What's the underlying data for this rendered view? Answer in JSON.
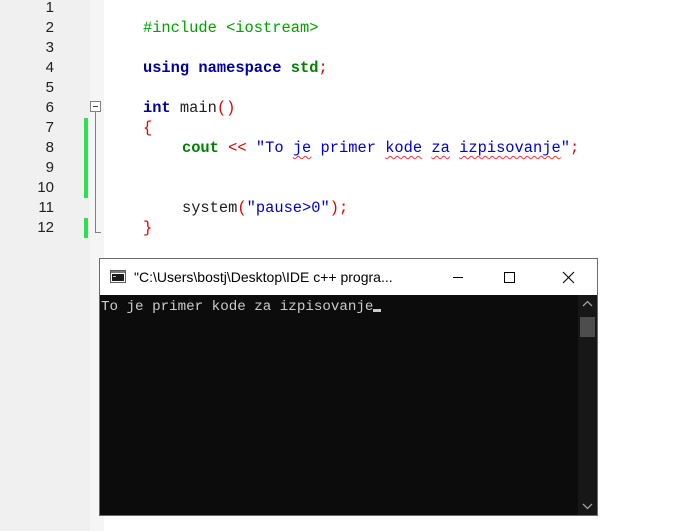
{
  "editor": {
    "line_numbers": [
      "1",
      "2",
      "3",
      "4",
      "5",
      "6",
      "7",
      "8",
      "9",
      "10",
      "11",
      "12"
    ],
    "lines": {
      "l1_include": "#include <iostream>",
      "l3_using": "using",
      "l3_namespace": "namespace",
      "l3_std": "std",
      "l3_semi": ";",
      "l5_int": "int",
      "l5_main": " main",
      "l5_parens": "()",
      "l6_brace": "{",
      "l7_cout": "cout",
      "l7_op": " << ",
      "l7_str_a": "\"To ",
      "l7_str_je": "je",
      "l7_str_b": " primer ",
      "l7_str_kode": "kode",
      "l7_str_c": " ",
      "l7_str_za": "za",
      "l7_str_d": " ",
      "l7_str_izp": "izpisovanje",
      "l7_str_e": "\"",
      "l7_semi": ";",
      "l10_system": "system",
      "l10_lp": "(",
      "l10_str": "\"pause>0\"",
      "l10_rp": ")",
      "l10_semi": ";",
      "l11_brace": "}"
    },
    "colors": {
      "preprocessor": "#00a000",
      "keyword": "#000099",
      "string": "#0000cc",
      "operator": "#e00000",
      "change_marker": "#2ee04f"
    }
  },
  "console": {
    "title": "\"C:\\Users\\bostj\\Desktop\\IDE c++ progra...",
    "output": "To je primer kode za izpisovanje",
    "icons": {
      "app": "console-app-icon",
      "minimize": "minimize-icon",
      "maximize": "maximize-icon",
      "close": "close-icon",
      "scroll_up": "chevron-up-icon",
      "scroll_down": "chevron-down-icon"
    }
  }
}
